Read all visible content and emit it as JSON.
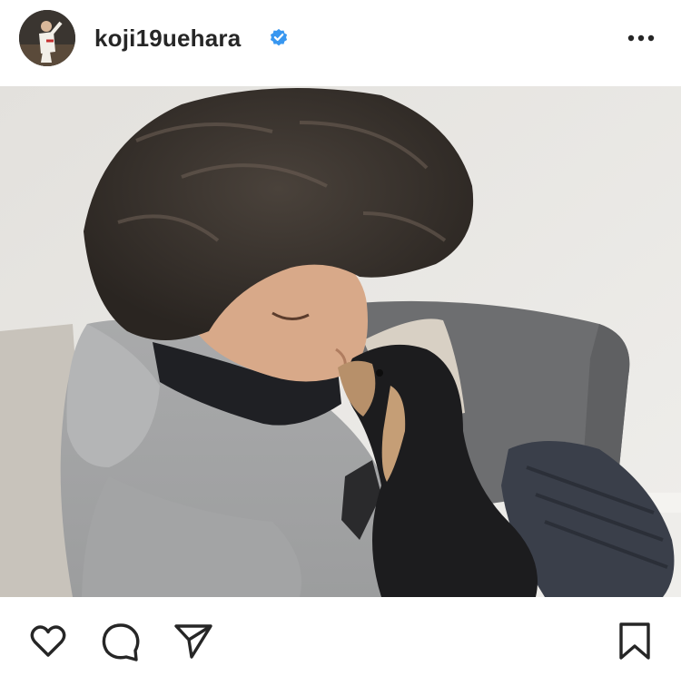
{
  "post": {
    "username": "koji19uehara",
    "verified": true,
    "verified_color": "#3897f0"
  },
  "icons": {
    "avatar": "profile-avatar",
    "verified": "verified-badge-icon",
    "more": "more-options-icon",
    "like": "heart-icon",
    "comment": "comment-bubble-icon",
    "share": "paper-plane-icon",
    "save": "bookmark-icon"
  }
}
